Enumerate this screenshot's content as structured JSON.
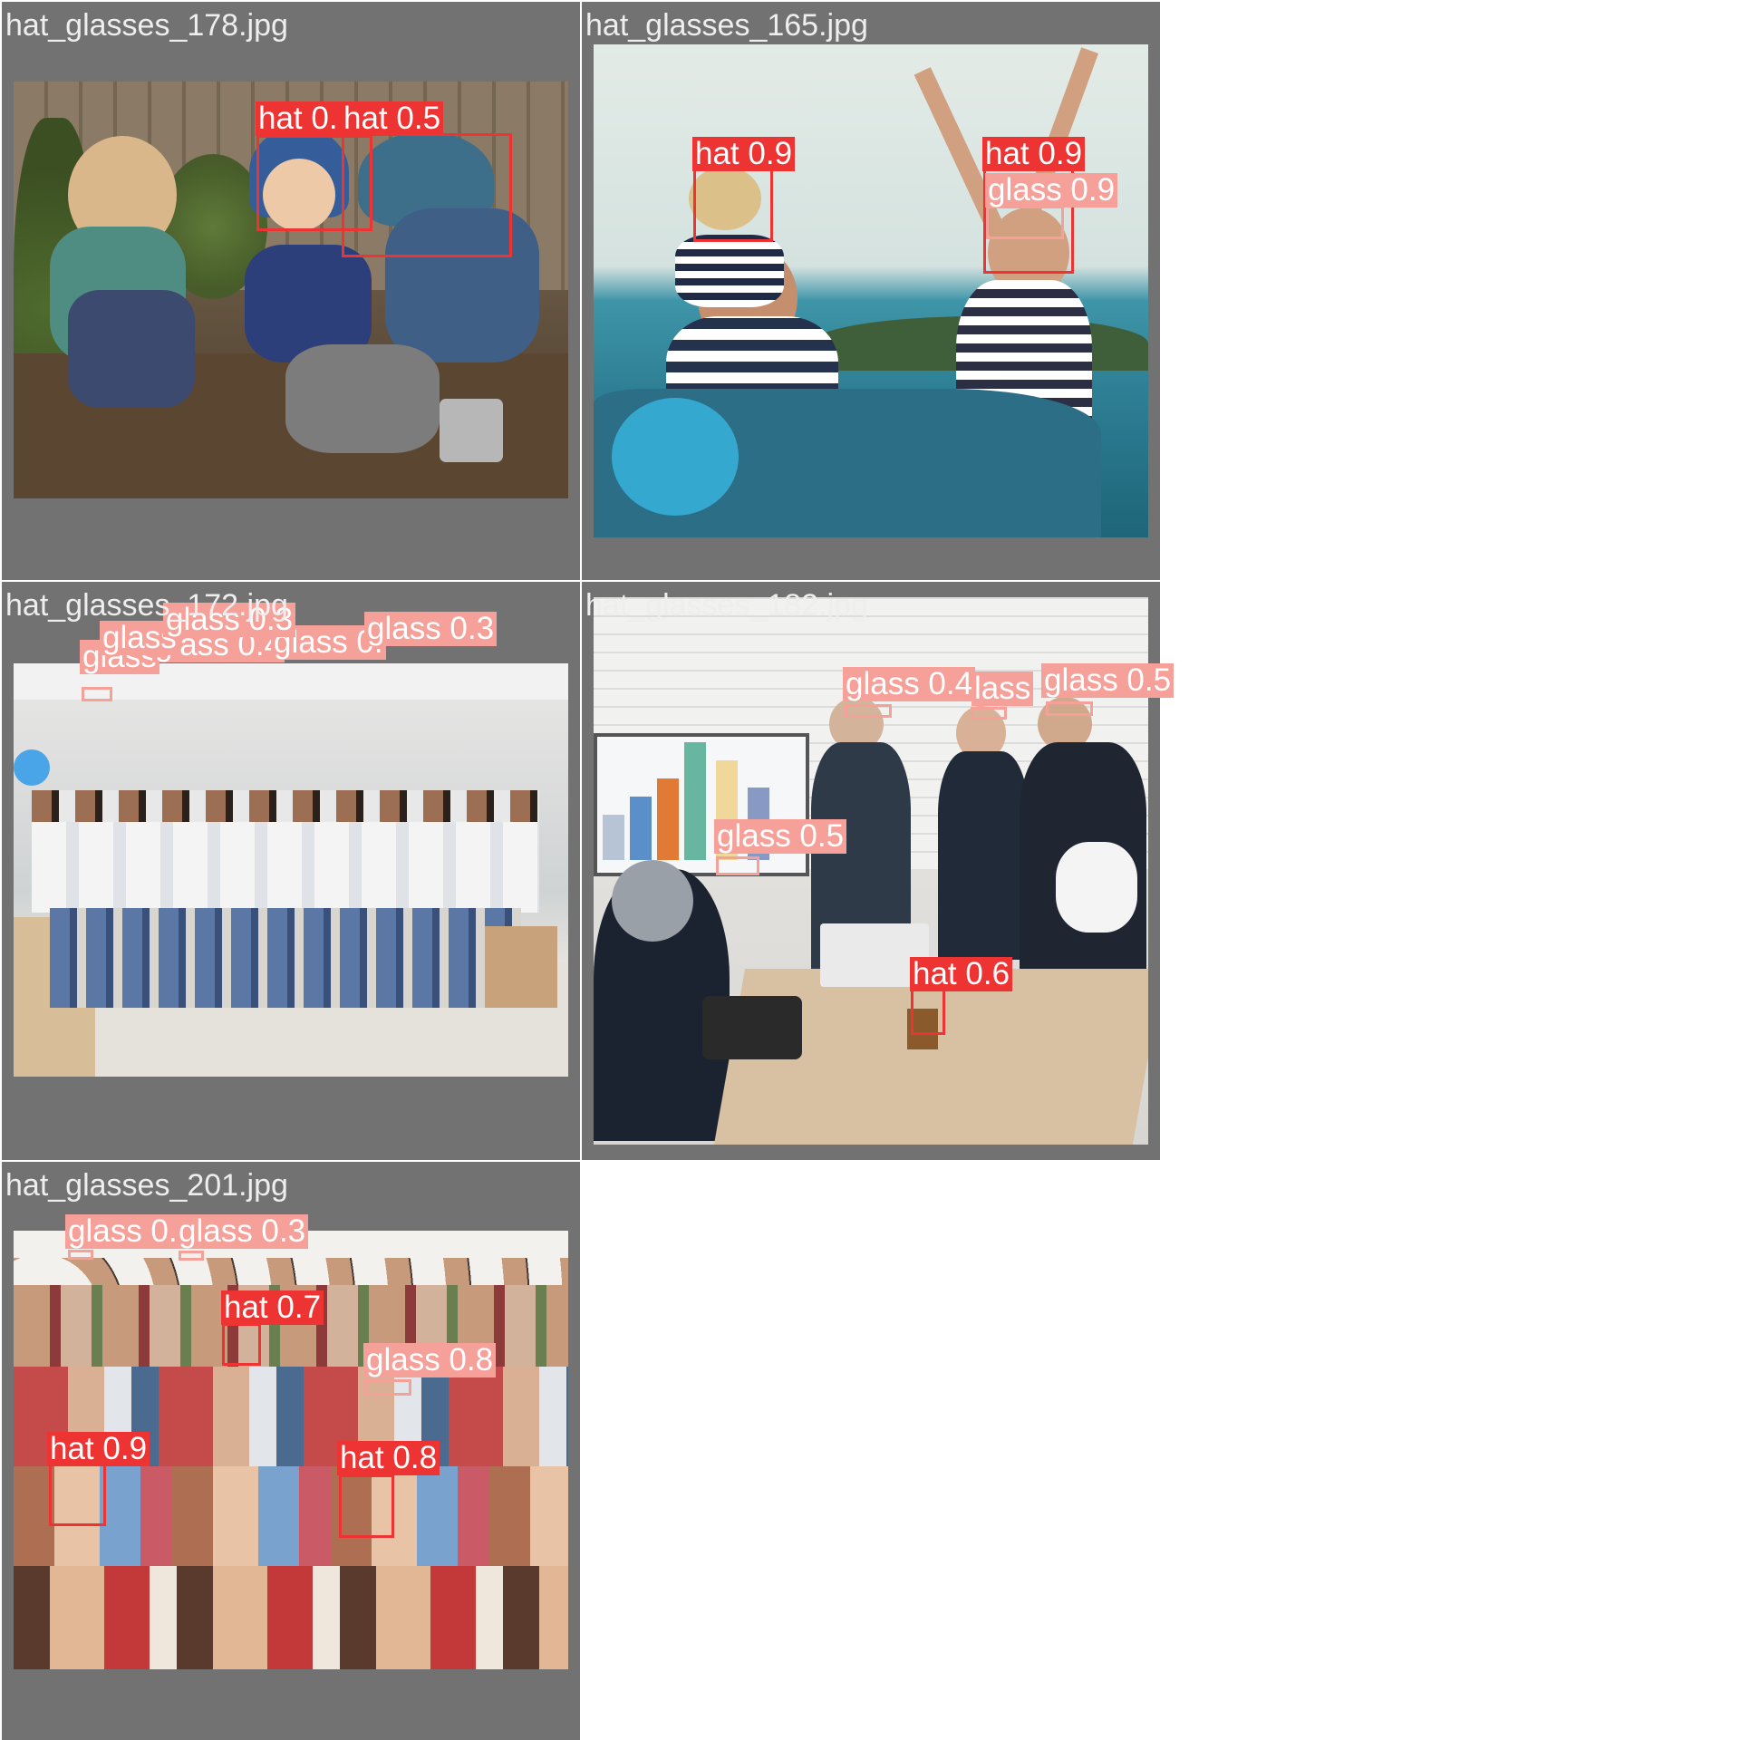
{
  "colors": {
    "hat": "#ee3333",
    "glass": "#f6a09a",
    "tile_bg": "#727272"
  },
  "tiles": [
    {
      "title": "hat_glasses_178.jpg",
      "detections": [
        {
          "label": "hat 0.",
          "class": "hat"
        },
        {
          "label": "hat 0.5",
          "class": "hat"
        }
      ]
    },
    {
      "title": "hat_glasses_165.jpg",
      "detections": [
        {
          "label": "hat 0.9",
          "class": "hat"
        },
        {
          "label": "hat 0.9",
          "class": "hat"
        },
        {
          "label": "glass 0.9",
          "class": "glass"
        }
      ]
    },
    {
      "title": "hat_glasses_172.jpg",
      "detections": [
        {
          "label": "glass 0.3",
          "class": "glass"
        },
        {
          "label": "glass 0.3",
          "class": "glass"
        },
        {
          "label": "glass",
          "class": "glass"
        },
        {
          "label": "glass 0.4",
          "class": "glass"
        },
        {
          "label": "glass 0.",
          "class": "glass"
        },
        {
          "label": "glass",
          "class": "glass"
        }
      ]
    },
    {
      "title": "hat_glasses_182.jpg",
      "detections": [
        {
          "label": "glass 0.4",
          "class": "glass"
        },
        {
          "label": "lass",
          "class": "glass"
        },
        {
          "label": "glass 0.5",
          "class": "glass"
        },
        {
          "label": "glass 0.5",
          "class": "glass"
        },
        {
          "label": "hat 0.6",
          "class": "hat"
        }
      ]
    },
    {
      "title": "hat_glasses_201.jpg",
      "detections": [
        {
          "label": "glass 0.3",
          "class": "glass"
        },
        {
          "label": "glass 0.3",
          "class": "glass"
        },
        {
          "label": "hat 0.7",
          "class": "hat"
        },
        {
          "label": "glass 0.8",
          "class": "glass"
        },
        {
          "label": "hat 0.9",
          "class": "hat"
        },
        {
          "label": "hat 0.8",
          "class": "hat"
        }
      ]
    }
  ]
}
